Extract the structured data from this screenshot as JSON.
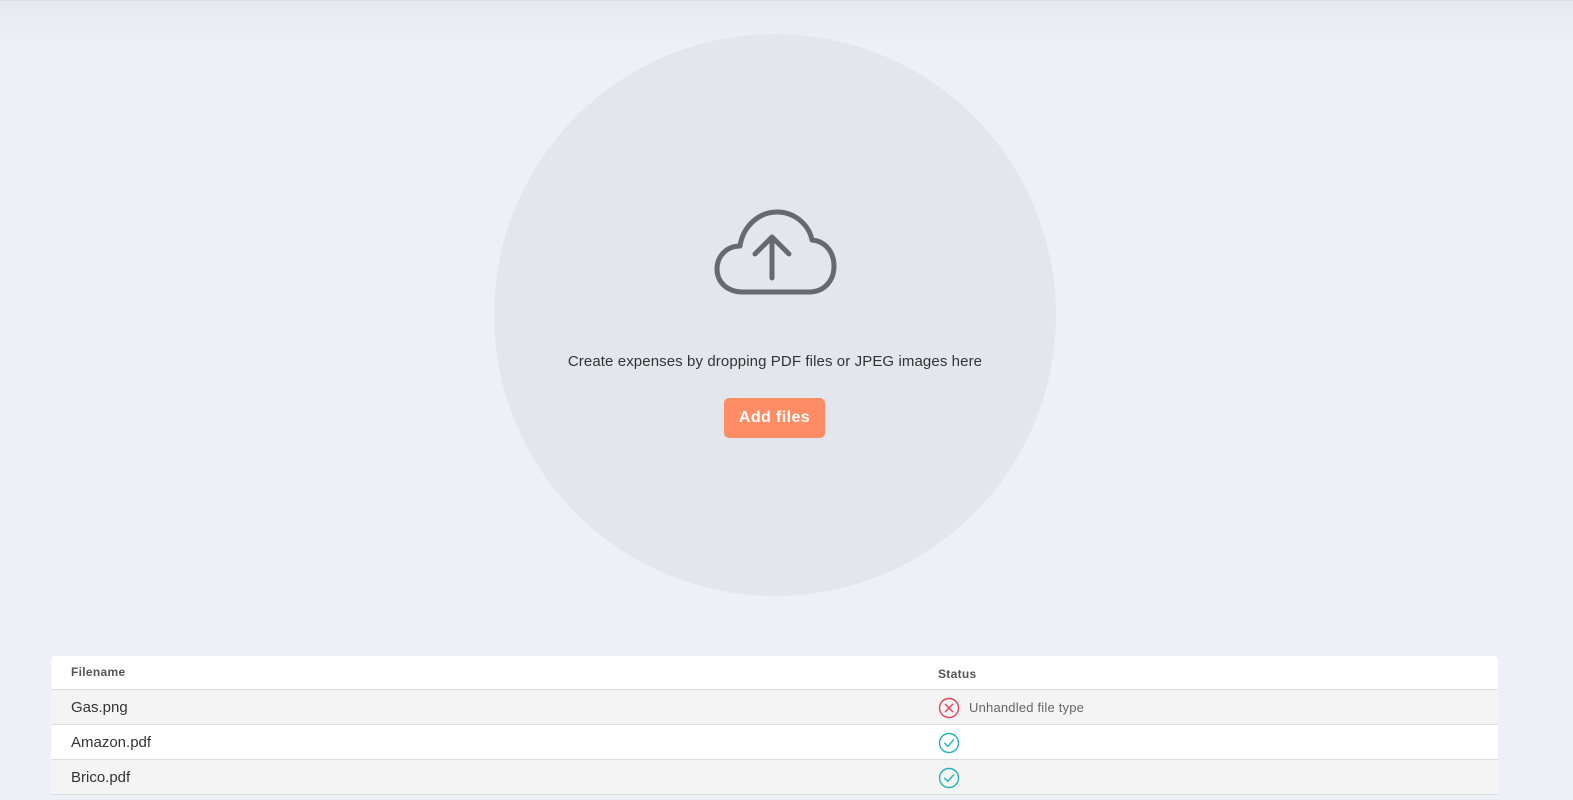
{
  "dropzone": {
    "icon": "cloud-upload-icon",
    "text": "Create expenses by dropping PDF files or JPEG images here",
    "button_label": "Add files"
  },
  "colors": {
    "accent": "#fe8c64",
    "error": "#e4425a",
    "success": "#21b3b6"
  },
  "table": {
    "headers": {
      "filename": "Filename",
      "status": "Status"
    },
    "rows": [
      {
        "filename": "Gas.png",
        "status": "error",
        "status_icon": "error-circle-x-icon",
        "status_text": "Unhandled file type"
      },
      {
        "filename": "Amazon.pdf",
        "status": "success",
        "status_icon": "success-circle-check-icon",
        "status_text": ""
      },
      {
        "filename": "Brico.pdf",
        "status": "success",
        "status_icon": "success-circle-check-icon",
        "status_text": ""
      }
    ]
  }
}
